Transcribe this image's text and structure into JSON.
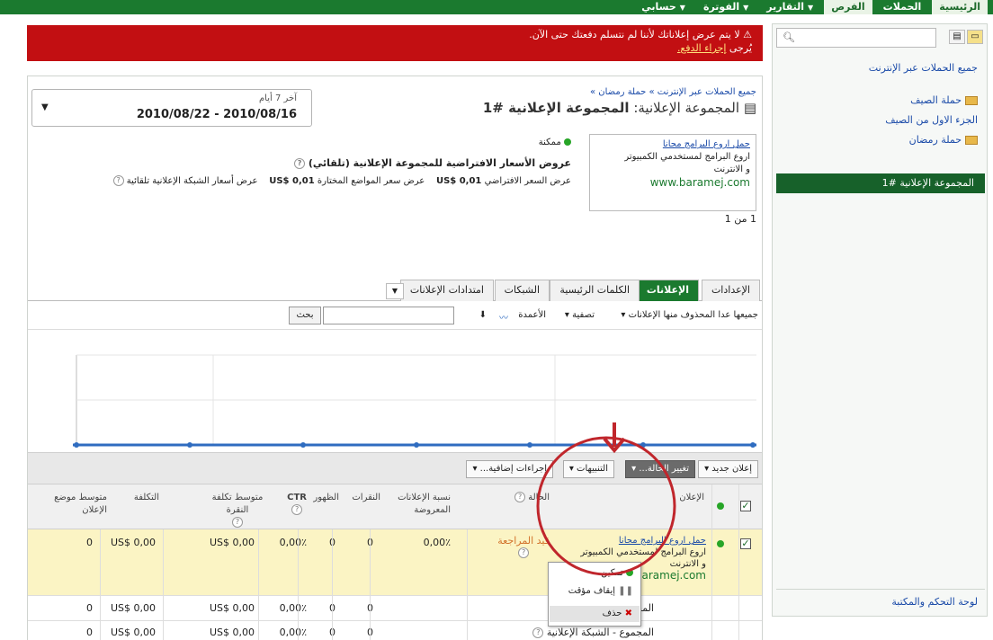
{
  "topnav": {
    "tabs": [
      {
        "label": "الرئيسية",
        "active": false
      },
      {
        "label": "الحملات",
        "active": true
      },
      {
        "label": "الفرص",
        "active": false
      },
      {
        "label": "التقارير",
        "dropdown": true
      },
      {
        "label": "الفوترة",
        "dropdown": true
      },
      {
        "label": "حسابي",
        "dropdown": true
      }
    ]
  },
  "sidebar": {
    "title": "جميع الحملات عبر الإنترنت",
    "items": [
      {
        "label": "حملة الصيف",
        "type": "folder"
      },
      {
        "label": "الجزء الاول من الصيف",
        "type": "adgroup"
      },
      {
        "label": "حملة رمضان",
        "type": "folder"
      }
    ],
    "selected": "المجموعة الإعلانية #1",
    "bottom_link": "لوحة التحكم والمكتبة"
  },
  "alert": {
    "line1": "لا يتم عرض إعلاناتك لأننا لم نتسلم دفعتك حتى الآن.",
    "line2_prefix": "يُرجى",
    "line2_link": "إجراء الدفع."
  },
  "daterange": {
    "label": "آخر 7 أيام",
    "value": "2010/08/22 - 2010/08/16"
  },
  "breadcrumb": "جميع الحملات عبر الإنترنت » حملة رمضان »",
  "page_title": {
    "prefix": "المجموعة الإعلانية:",
    "name": "المجموعة الإعلانية #1"
  },
  "ad": {
    "headline": "حمل اروع البرامج مجانا",
    "line1": "اروع البرامج لمستخدمي الكمبيوتر",
    "line2": "و الانترنت",
    "url": "www.baramej.com",
    "pager": "1 من 1"
  },
  "status": "ممكنة",
  "bids": {
    "title": "عروض الأسعار الافتراضية للمجموعة الإعلانية (تلقائي)",
    "default_label": "عرض السعر الافتراضي",
    "default_value": "US$ 0,01",
    "placement_label": "عرض سعر المواضع المختارة",
    "placement_value": "US$ 0,01",
    "network_label": "عرض أسعار الشبكة الإعلانية تلقائية"
  },
  "tabs": [
    {
      "label": "الإعدادات",
      "active": false
    },
    {
      "label": "الإعلانات",
      "active": true
    },
    {
      "label": "الكلمات الرئيسية",
      "active": false
    },
    {
      "label": "الشبكات",
      "active": false
    },
    {
      "label": "امتدادات الإعلانات",
      "active": false
    }
  ],
  "toolbar": {
    "filter_all": "جميعها عدا المحذوف منها الإعلانات",
    "filter": "تصفية",
    "columns": "الأعمدة",
    "search_button": "بحث"
  },
  "actions": {
    "new_ad": "إعلان جديد",
    "change_status": "تغيير الحالة...",
    "alerts": "التنبيهات",
    "more_actions": "إجراءات إضافية..."
  },
  "dropdown": {
    "enable": "تمكين",
    "pause": "إيقاف مؤقت",
    "delete": "حذف"
  },
  "table": {
    "headers": {
      "ad": "الإعلان",
      "status": "الحالة",
      "served_pct": "نسبة الإعلانات المعروضة",
      "clicks": "النقرات",
      "impressions": "الظهور",
      "ctr": "CTR",
      "avg_cpc": "متوسط تكلفة النقرة",
      "cost": "التكلفة",
      "avg_pos": "متوسط موضع الإعلان"
    },
    "row": {
      "ad_headline": "حمل اروع البرامج مجانا",
      "ad_line1": "اروع البرامج لمستخدمي الكمبيوتر",
      "ad_line2": "و الانترنت",
      "ad_url": "www.baramej.com",
      "status": "قيد المراجعة",
      "served_pct": "0,00٪",
      "clicks": "0",
      "impressions": "0",
      "ctr": "0,00٪",
      "avg_cpc": "US$ 0,00",
      "cost": "US$ 0,00",
      "avg_pos": "0"
    },
    "total_search": {
      "label": "المجموع - البحث",
      "clicks": "0",
      "impressions": "0",
      "ctr": "0,00٪",
      "avg_cpc": "US$ 0,00",
      "cost": "US$ 0,00",
      "avg_pos": "0"
    },
    "total_display": {
      "label": "المجموع - الشبكة الإعلانية",
      "clicks": "0",
      "impressions": "0",
      "ctr": "0,00٪",
      "avg_cpc": "US$ 0,00",
      "cost": "US$ 0,00",
      "avg_pos": "0"
    }
  },
  "colors": {
    "nav_green": "#1b7a2f",
    "alert_red": "#c20f12",
    "highlight_row": "#fbf4c4",
    "annotation_red": "#c0262c",
    "chart_line": "#2f6cc0"
  }
}
